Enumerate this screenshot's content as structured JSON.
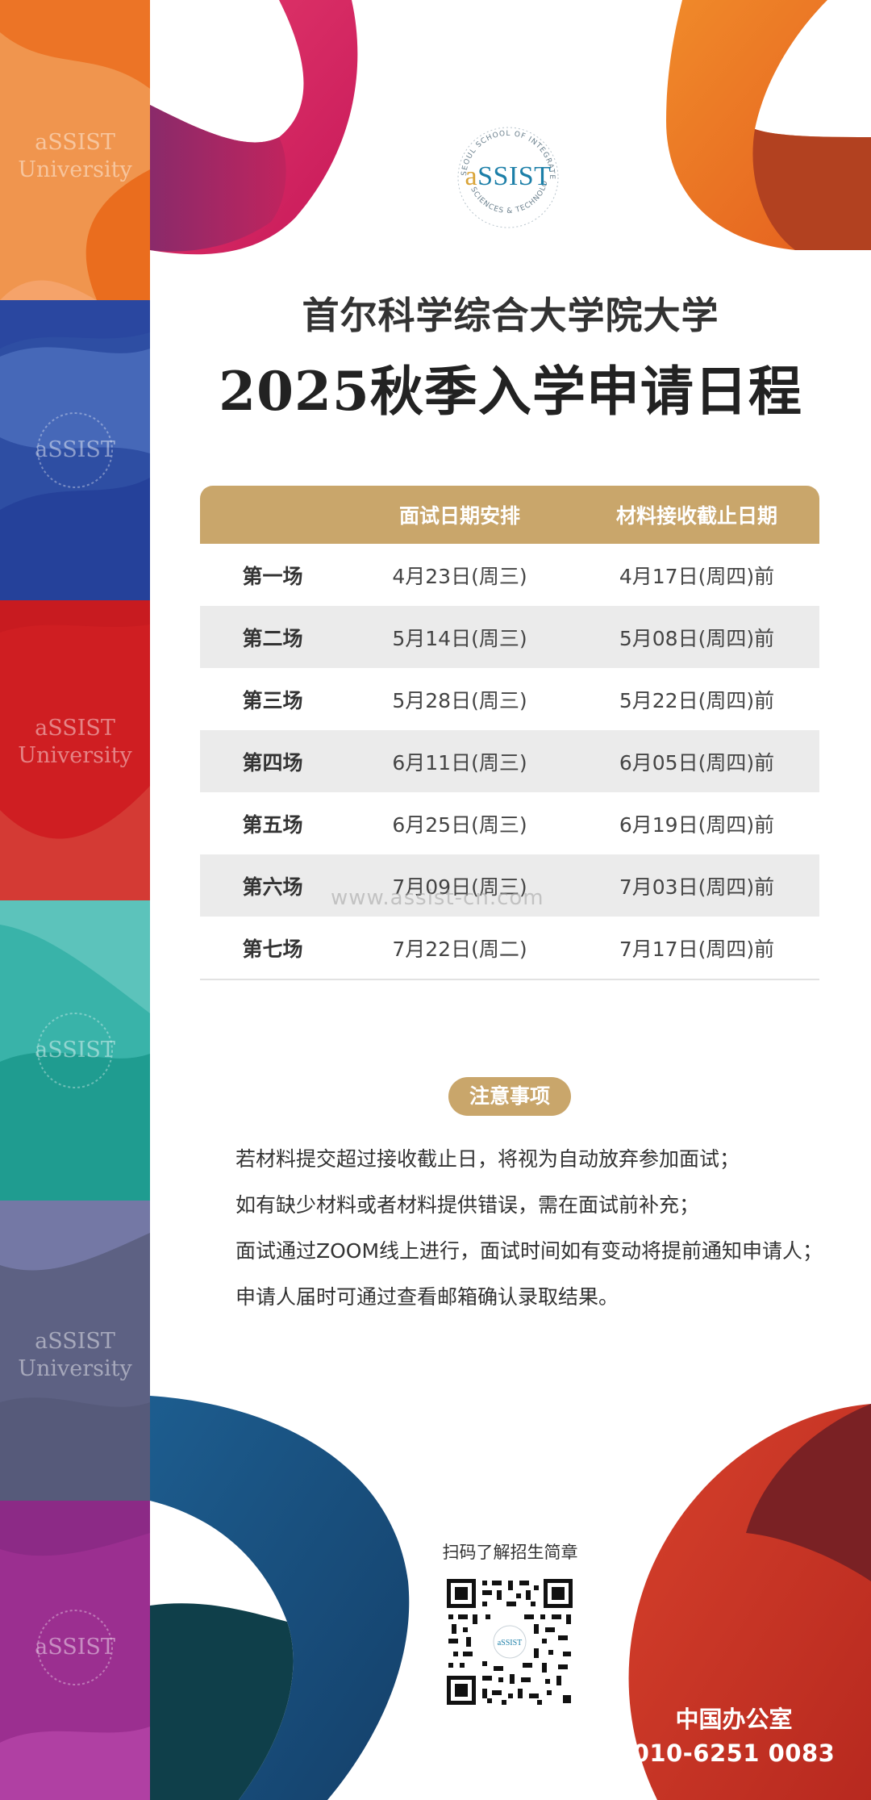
{
  "brand": {
    "logo_text": "SSIST",
    "logo_text_a": "a",
    "logo_arc_top": "SEOUL SCHOOL OF INTEGRATED",
    "logo_arc_bottom": "SCIENCES & TECHNOLOGIES",
    "colors": {
      "gold": "#c9a66b",
      "orange": "#ef7a2e",
      "blue": "#2f4fa5",
      "red": "#cc1f24",
      "teal": "#2fa99c",
      "slate": "#5d6183",
      "purple": "#9a2e8f"
    }
  },
  "side_panels": [
    {
      "label_line1": "aSSIST",
      "label_line2": "University"
    },
    {
      "label_line1": "aSSIST",
      "label_line2": ""
    },
    {
      "label_line1": "aSSIST",
      "label_line2": "University"
    },
    {
      "label_line1": "aSSIST",
      "label_line2": ""
    },
    {
      "label_line1": "aSSIST",
      "label_line2": "University"
    },
    {
      "label_line1": "aSSIST",
      "label_line2": ""
    }
  ],
  "header": {
    "subtitle": "首尔科学综合大学院大学",
    "title": "2025秋季入学申请日程"
  },
  "schedule": {
    "columns": [
      "",
      "面试日期安排",
      "材料接收截止日期"
    ],
    "rows": [
      {
        "session": "第一场",
        "interview": "4月23日(周三)",
        "deadline": "4月17日(周四)前"
      },
      {
        "session": "第二场",
        "interview": "5月14日(周三)",
        "deadline": "5月08日(周四)前"
      },
      {
        "session": "第三场",
        "interview": "5月28日(周三)",
        "deadline": "5月22日(周四)前"
      },
      {
        "session": "第四场",
        "interview": "6月11日(周三)",
        "deadline": "6月05日(周四)前"
      },
      {
        "session": "第五场",
        "interview": "6月25日(周三)",
        "deadline": "6月19日(周四)前"
      },
      {
        "session": "第六场",
        "interview": "7月09日(周三)",
        "deadline": "7月03日(周四)前"
      },
      {
        "session": "第七场",
        "interview": "7月22日(周二)",
        "deadline": "7月17日(周四)前"
      }
    ]
  },
  "watermark": "www.assist-cn.com",
  "notice": {
    "badge": "注意事项",
    "lines": [
      "若材料提交超过接收截止日，将视为自动放弃参加面试；",
      "如有缺少材料或者材料提供错误，需在面试前补充；",
      "面试通过ZOOM线上进行，面试时间如有变动将提前通知申请人；",
      "申请人届时可通过查看邮箱确认录取结果。"
    ]
  },
  "qr": {
    "caption": "扫码了解招生简章",
    "center_text": "aSSIST"
  },
  "contact": {
    "office": "中国办公室",
    "phone": "010-6251 0083"
  }
}
